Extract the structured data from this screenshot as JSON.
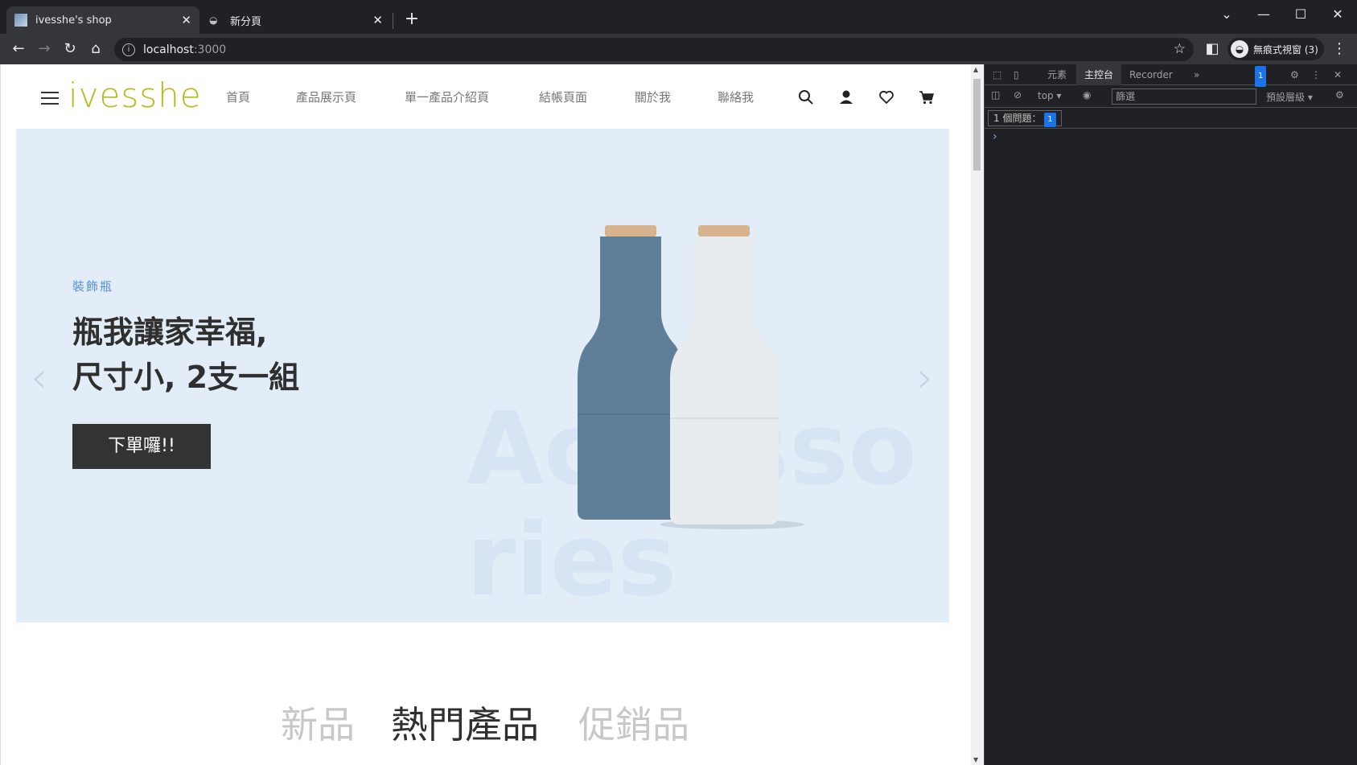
{
  "browser": {
    "tabs": [
      {
        "title": "ivesshe's shop",
        "active": true
      },
      {
        "title": "新分頁",
        "active": false
      }
    ],
    "new_tab": "+",
    "url_host": "localhost",
    "url_port": ":3000",
    "profile_label": "無痕式視窗 (3)"
  },
  "site": {
    "logo": "ivesshe",
    "nav": [
      "首頁",
      "產品展示頁",
      "單一產品介紹頁",
      "結帳頁面",
      "關於我",
      "聯絡我"
    ],
    "hero": {
      "category": "裝飾瓶",
      "title_line1": "瓶我讓家幸福,",
      "title_line2": "尺寸小, 2支一組",
      "button": "下單囉!!",
      "background_text": "Accessories",
      "prev": "‹",
      "next": "›"
    },
    "product_tabs": [
      "新品",
      "熱門產品",
      "促銷品"
    ],
    "active_product_tab": "熱門產品",
    "colors": {
      "logo": "#b5bb1e",
      "hero_bg": "#e2edf8",
      "category": "#5b8fd0"
    }
  },
  "devtools": {
    "tabs": [
      "元素",
      "主控台",
      "Recorder"
    ],
    "active_tab": "主控台",
    "issue_badge": "1",
    "context": "top",
    "filter_placeholder": "篩選",
    "levels": "預設層級",
    "issues_label": "1 個問題：",
    "issues_count": "1",
    "prompt": "›"
  }
}
